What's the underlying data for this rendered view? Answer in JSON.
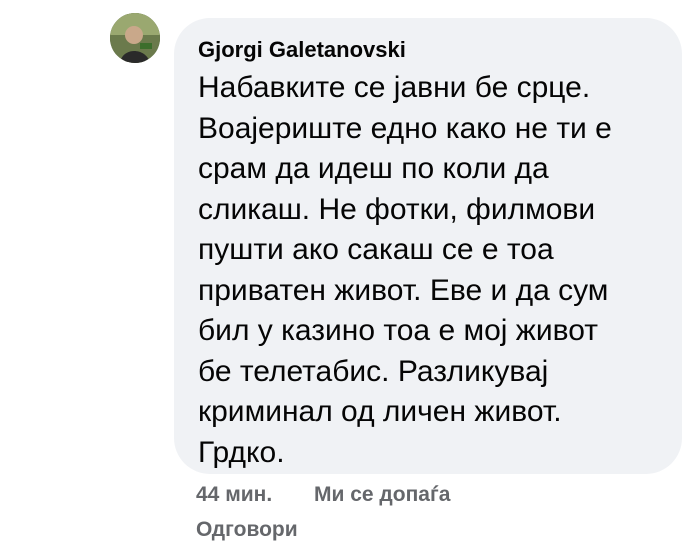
{
  "comment": {
    "author": "Gjorgi Galetanovski",
    "lines": [
      "Набавките се јавни бе срце.",
      "Воајериште едно како не ти е",
      "срам да идеш по коли да",
      "сликаш. Не фотки, филмови",
      "пушти ако сакаш се е тоа",
      "приватен живот. Еве и да сум",
      "бил у казино тоа е мој живот",
      "бе телетабис. Разликувај",
      "криминал од личен живот.",
      "Грдко."
    ],
    "time": "44 мин.",
    "like_label": "Ми се допаѓа",
    "reply_label": "Одговори"
  },
  "colors": {
    "bubble_bg": "#f0f2f5",
    "text": "#050505",
    "secondary": "#65676b"
  }
}
